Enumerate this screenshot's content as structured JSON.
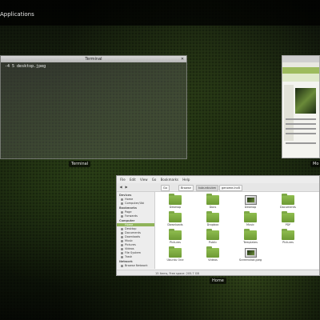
{
  "topbar": {
    "activities": "Applications"
  },
  "terminal": {
    "title": "Terminal",
    "command_line": "-4 5 desktop.jpeg",
    "caption": "Terminal"
  },
  "browser": {
    "caption": "Mo"
  },
  "file_manager": {
    "caption": "Home",
    "menu": [
      "File",
      "Edit",
      "View",
      "Go",
      "Bookmarks",
      "Help"
    ],
    "path": [
      "Go",
      "Browse",
      "kubuntuvbm",
      "genome-lnc8"
    ],
    "sidebar": {
      "sections": [
        {
          "header": "Devices",
          "items": [
            "Home",
            "Computer/Ubi"
          ]
        },
        {
          "header": "Bookmarks",
          "items": [
            "Page",
            "Forwards"
          ]
        },
        {
          "header": "Computer",
          "items": [
            "Home",
            "Desktop",
            "Documents",
            "Downloads",
            "Music",
            "Pictures",
            "Videos",
            "File System",
            "Trash"
          ]
        },
        {
          "header": "Network",
          "items": [
            "Browse Network"
          ]
        }
      ],
      "selected": "Home"
    },
    "items": [
      {
        "label": "Desktop",
        "kind": "folder"
      },
      {
        "label": "Docs",
        "kind": "folder"
      },
      {
        "label": "Desktop",
        "kind": "image"
      },
      {
        "label": "Documents",
        "kind": "folder"
      },
      {
        "label": "Downloads",
        "kind": "folder"
      },
      {
        "label": "Dropbox",
        "kind": "folder"
      },
      {
        "label": "Music",
        "kind": "folder"
      },
      {
        "label": "PDF",
        "kind": "folder"
      },
      {
        "label": "Pictures",
        "kind": "folder"
      },
      {
        "label": "Public",
        "kind": "folder"
      },
      {
        "label": "Templates",
        "kind": "folder"
      },
      {
        "label": "Pictures",
        "kind": "folder"
      },
      {
        "label": "Ubuntu One",
        "kind": "folder"
      },
      {
        "label": "Videos",
        "kind": "folder"
      },
      {
        "label": "Screenshot.jpeg",
        "kind": "image"
      }
    ],
    "status": "15 items, Free space: 205.7 GB"
  },
  "colors": {
    "accent": "#8fb35a",
    "folder": "#7ea947"
  }
}
